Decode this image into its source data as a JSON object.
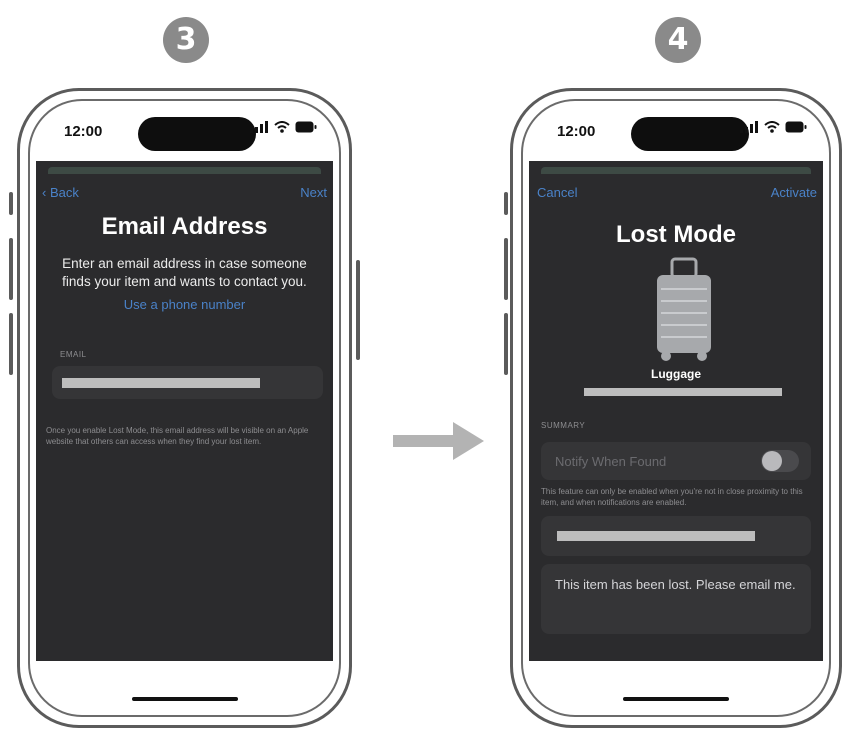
{
  "steps": [
    "3",
    "4"
  ],
  "status": {
    "time": "12:00"
  },
  "left": {
    "back_label": "Back",
    "next_label": "Next",
    "title": "Email Address",
    "description": "Enter an email address in case someone finds your item and wants to contact you.",
    "phone_link": "Use a phone number",
    "email_label": "EMAIL",
    "footnote": "Once you enable Lost Mode, this email address will be visible on an Apple website that others can access when they find your lost item."
  },
  "right": {
    "cancel_label": "Cancel",
    "activate_label": "Activate",
    "title": "Lost Mode",
    "item_name": "Luggage",
    "summary_label": "SUMMARY",
    "notify_label": "Notify When Found",
    "notify_on": false,
    "notify_note": "This feature can only be enabled when you're not in close proximity to this item, and when notifications are enabled.",
    "message": "This item has been lost. Please email me."
  },
  "colors": {
    "accent": "#4a82c8",
    "screen_bg": "#2b2b2d",
    "step_badge": "#8a8a8a",
    "arrow": "#b3b3b3"
  }
}
